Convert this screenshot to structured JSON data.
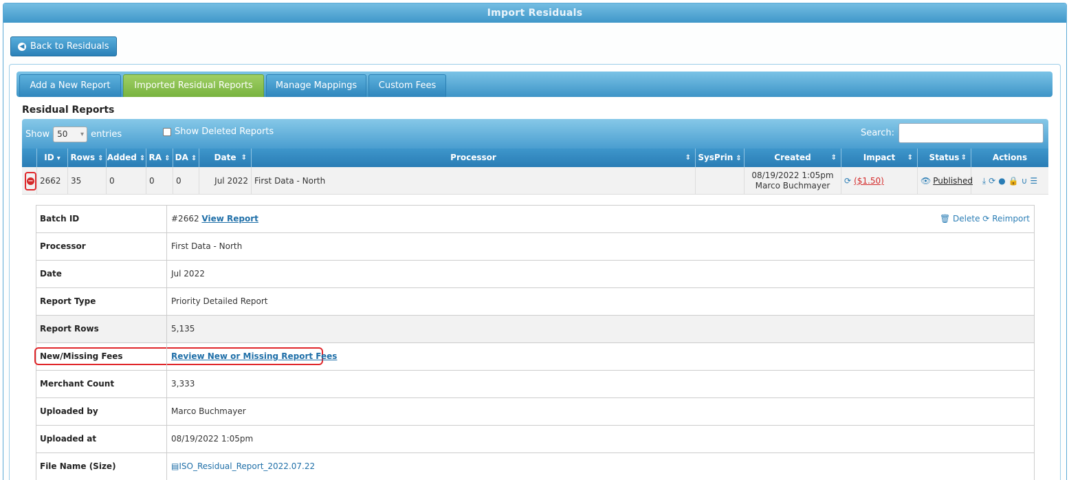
{
  "window": {
    "title": "Import Residuals"
  },
  "back_button": {
    "label": "Back to Residuals",
    "icon": "circle-arrow-left-icon"
  },
  "tabs": [
    {
      "label": "Add a New Report",
      "active": false
    },
    {
      "label": "Imported Residual Reports",
      "active": true
    },
    {
      "label": "Manage Mappings",
      "active": false
    },
    {
      "label": "Custom Fees",
      "active": false
    }
  ],
  "section_title": "Residual Reports",
  "toolbar": {
    "show_label": "Show",
    "entries_value": "50",
    "entries_label": "entries",
    "show_deleted_label": "Show Deleted Reports",
    "show_deleted_checked": false,
    "search_label": "Search:",
    "search_value": ""
  },
  "columns": [
    "ID",
    "Rows",
    "Added",
    "RA",
    "DA",
    "Date",
    "Processor",
    "SysPrin",
    "Created",
    "Impact",
    "Status",
    "Actions"
  ],
  "row": {
    "id": "2662",
    "rows": "35",
    "added": "0",
    "ra": "0",
    "da": "0",
    "date": "Jul 2022",
    "processor": "First Data - North",
    "sysprin": "",
    "created_date": "08/19/2022 1:05pm",
    "created_by": "Marco Buchmayer",
    "impact": "($1.50)",
    "status": "Published",
    "action_icons": [
      "download-icon",
      "refresh-icon",
      "comment-icon",
      "lock-icon",
      "magnet-icon",
      "list-icon"
    ]
  },
  "details": {
    "batch_id_label": "Batch ID",
    "batch_id_value": "#2662",
    "view_report_label": "View Report",
    "delete_label": "Delete",
    "reimport_label": "Reimport",
    "processor_label": "Processor",
    "processor_value": "First Data - North",
    "date_label": "Date",
    "date_value": "Jul 2022",
    "report_type_label": "Report Type",
    "report_type_value": "Priority Detailed Report",
    "report_rows_label": "Report Rows",
    "report_rows_value": "5,135",
    "fees_label": "New/Missing Fees",
    "fees_link": "Review New or Missing Report Fees",
    "merchant_count_label": "Merchant Count",
    "merchant_count_value": "3,333",
    "uploaded_by_label": "Uploaded by",
    "uploaded_by_value": "Marco Buchmayer",
    "uploaded_at_label": "Uploaded at",
    "uploaded_at_value": "08/19/2022 1:05pm",
    "file_name_label": "File Name (Size)",
    "file_name_value": "ISO_Residual_Report_2022.07.22"
  },
  "colors": {
    "accent_blue": "#2a7db5",
    "active_tab": "#86c14e",
    "negative": "#d42a2a",
    "highlight_border": "#e0262a"
  }
}
